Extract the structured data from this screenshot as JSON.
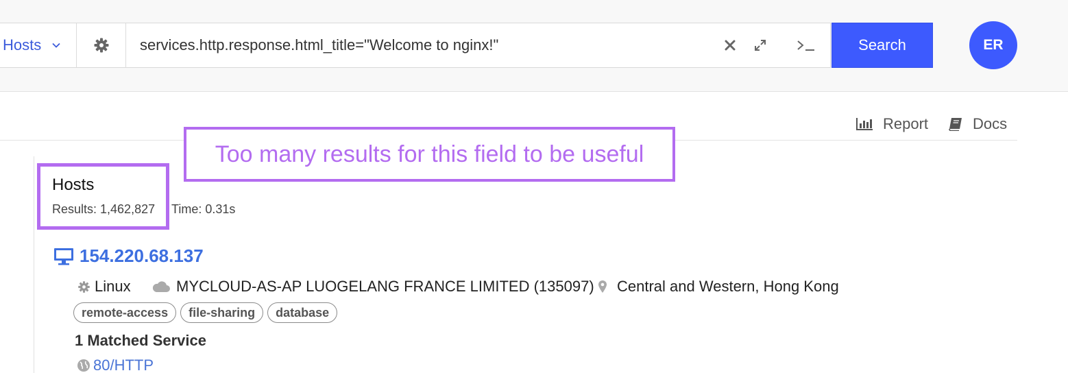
{
  "search": {
    "type_label": "Hosts",
    "query": "services.http.response.html_title=\"Welcome to nginx!\"",
    "button_label": "Search"
  },
  "user": {
    "initials": "ER"
  },
  "toolbar": {
    "report_label": "Report",
    "docs_label": "Docs"
  },
  "annotation": {
    "text": "Too many results for this field to be useful"
  },
  "results": {
    "title": "Hosts",
    "count_text": "Results: 1,462,827",
    "time_text": "Time: 0.31s"
  },
  "host": {
    "ip": "154.220.68.137",
    "os": "Linux",
    "asn": "MYCLOUD-AS-AP LUOGELANG FRANCE LIMITED (135097)",
    "location": "Central and Western, Hong Kong",
    "tags": [
      "remote-access",
      "file-sharing",
      "database"
    ],
    "matched_label": "1 Matched Service",
    "service": "80/HTTP"
  },
  "colors": {
    "accent": "#3d5afe",
    "annotation": "#b36cf0",
    "link": "#3d6fe0"
  },
  "icons": [
    "chevron-down-icon",
    "gear-icon",
    "clear-icon",
    "expand-icon",
    "terminal-icon",
    "report-chart-icon",
    "book-icon",
    "monitor-icon",
    "cloud-icon",
    "map-pin-icon",
    "globe-icon"
  ]
}
